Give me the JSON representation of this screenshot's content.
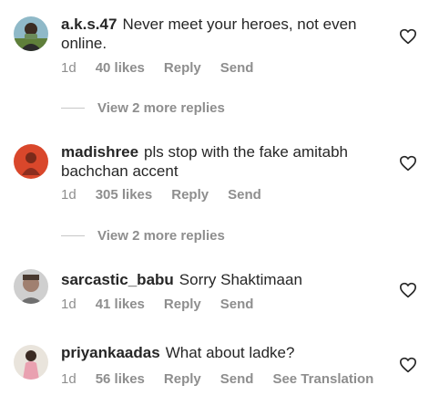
{
  "comments": [
    {
      "username": "a.k.s.47",
      "text": "Never meet your heroes, not even online.",
      "age": "1d",
      "likes": "40 likes",
      "reply": "Reply",
      "send": "Send",
      "view_replies": "View 2 more replies"
    },
    {
      "username": "madishree",
      "text": "pls stop with the fake amitabh bachchan accent",
      "age": "1d",
      "likes": "305 likes",
      "reply": "Reply",
      "send": "Send",
      "view_replies": "View 2 more replies"
    },
    {
      "username": "sarcastic_babu",
      "text": "Sorry Shaktimaan",
      "age": "1d",
      "likes": "41 likes",
      "reply": "Reply",
      "send": "Send"
    },
    {
      "username": "priyankaadas",
      "text": "What about ladke?",
      "age": "1d",
      "likes": "56 likes",
      "reply": "Reply",
      "send": "Send",
      "see_translation": "See Translation"
    }
  ],
  "icons": {
    "like": "heart-outline-icon"
  },
  "colors": {
    "text": "#262626",
    "secondary": "#8e8e8e",
    "background": "#ffffff"
  }
}
